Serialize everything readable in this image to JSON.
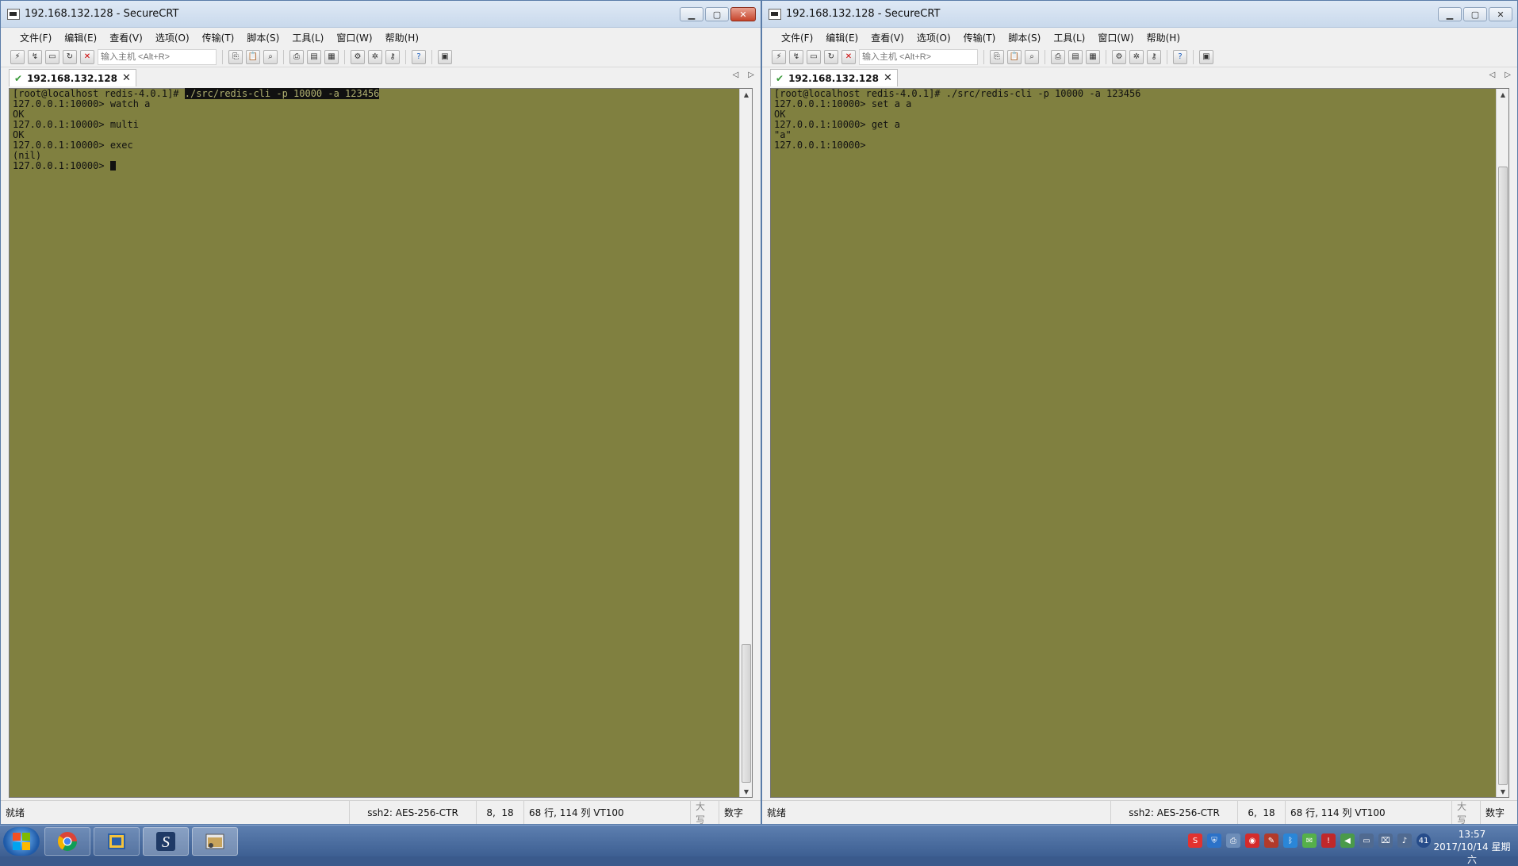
{
  "windows": [
    {
      "id": "left",
      "title": "192.168.132.128 - SecureCRT",
      "menu": [
        "文件(F)",
        "编辑(E)",
        "查看(V)",
        "选项(O)",
        "传输(T)",
        "脚本(S)",
        "工具(L)",
        "窗口(W)",
        "帮助(H)"
      ],
      "host_placeholder": "输入主机 <Alt+R>",
      "tab_label": "192.168.132.128",
      "terminal": {
        "prompt_first": "[root@localhost redis-4.0.1]# ",
        "command_first": "./src/redis-cli -p 10000 -a 123456",
        "lines": [
          "127.0.0.1:10000> watch a",
          "OK",
          "127.0.0.1:10000> multi",
          "OK",
          "127.0.0.1:10000> exec",
          "(nil)"
        ],
        "last_prompt": "127.0.0.1:10000> "
      },
      "status": {
        "ready": "就绪",
        "cipher": "ssh2: AES-256-CTR",
        "cursor_pos": "8,  18",
        "size": "68 行, 114 列 VT100",
        "caps": "大写",
        "num": "数字"
      }
    },
    {
      "id": "right",
      "title": "192.168.132.128 - SecureCRT",
      "menu": [
        "文件(F)",
        "编辑(E)",
        "查看(V)",
        "选项(O)",
        "传输(T)",
        "脚本(S)",
        "工具(L)",
        "窗口(W)",
        "帮助(H)"
      ],
      "host_placeholder": "输入主机 <Alt+R>",
      "tab_label": "192.168.132.128",
      "terminal": {
        "prompt_first": "[root@localhost redis-4.0.1]# ",
        "command_first": "./src/redis-cli -p 10000 -a 123456",
        "lines": [
          "127.0.0.1:10000> set a a",
          "OK",
          "127.0.0.1:10000> get a",
          "\"a\""
        ],
        "last_prompt": "127.0.0.1:10000>"
      },
      "status": {
        "ready": "就绪",
        "cipher": "ssh2: AES-256-CTR",
        "cursor_pos": "6,  18",
        "size": "68 行, 114 列 VT100",
        "caps": "大写",
        "num": "数字"
      }
    }
  ],
  "colors": {
    "terminal_bg": "#808040",
    "terminal_fg": "#111111",
    "taskbar": "#4a6ea2"
  },
  "taskbar": {
    "clock_time": "13:57",
    "clock_date": "2017/10/14 星期六",
    "tray_badge": "41",
    "apps": [
      "chrome-icon",
      "virtualbox-icon",
      "securecrt-icon",
      "explorer-icon"
    ]
  }
}
